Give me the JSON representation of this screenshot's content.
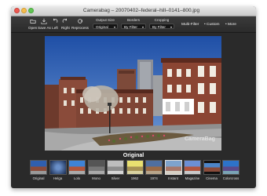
{
  "window": {
    "title": "Camerabag – 20070402–federal–hill–0141–800.jpg"
  },
  "toolbar": {
    "buttons": [
      {
        "label": "Open",
        "icon": "folder-icon"
      },
      {
        "label": "Save As",
        "icon": "save-icon"
      },
      {
        "label": "Left",
        "icon": "rotate-left-icon"
      },
      {
        "label": "Right",
        "icon": "rotate-right-icon"
      },
      {
        "label": "Reprocess",
        "icon": "reprocess-icon"
      }
    ],
    "output_size": {
      "label": "Output Size",
      "value": "Original"
    },
    "borders": {
      "label": "Borders",
      "value": "By Filter"
    },
    "cropping": {
      "label": "Cropping",
      "value": "By Filter"
    },
    "multi_filter": "Multi-Filter",
    "custom": "Custom",
    "more": "More"
  },
  "photo": {
    "watermark": "CameraBag"
  },
  "preview": {
    "current_filter": "Original"
  },
  "filters": [
    {
      "label": "Original"
    },
    {
      "label": "Helga"
    },
    {
      "label": "Lolo"
    },
    {
      "label": "Mono"
    },
    {
      "label": "Silver"
    },
    {
      "label": "1962"
    },
    {
      "label": "1974"
    },
    {
      "label": "Instant"
    },
    {
      "label": "Magazine"
    },
    {
      "label": "Cinema"
    },
    {
      "label": "Colorcross"
    }
  ],
  "colors": {
    "window_bg": "#2a2a2a",
    "sky": "#2f5fae",
    "brick": "#8a4b3a"
  }
}
